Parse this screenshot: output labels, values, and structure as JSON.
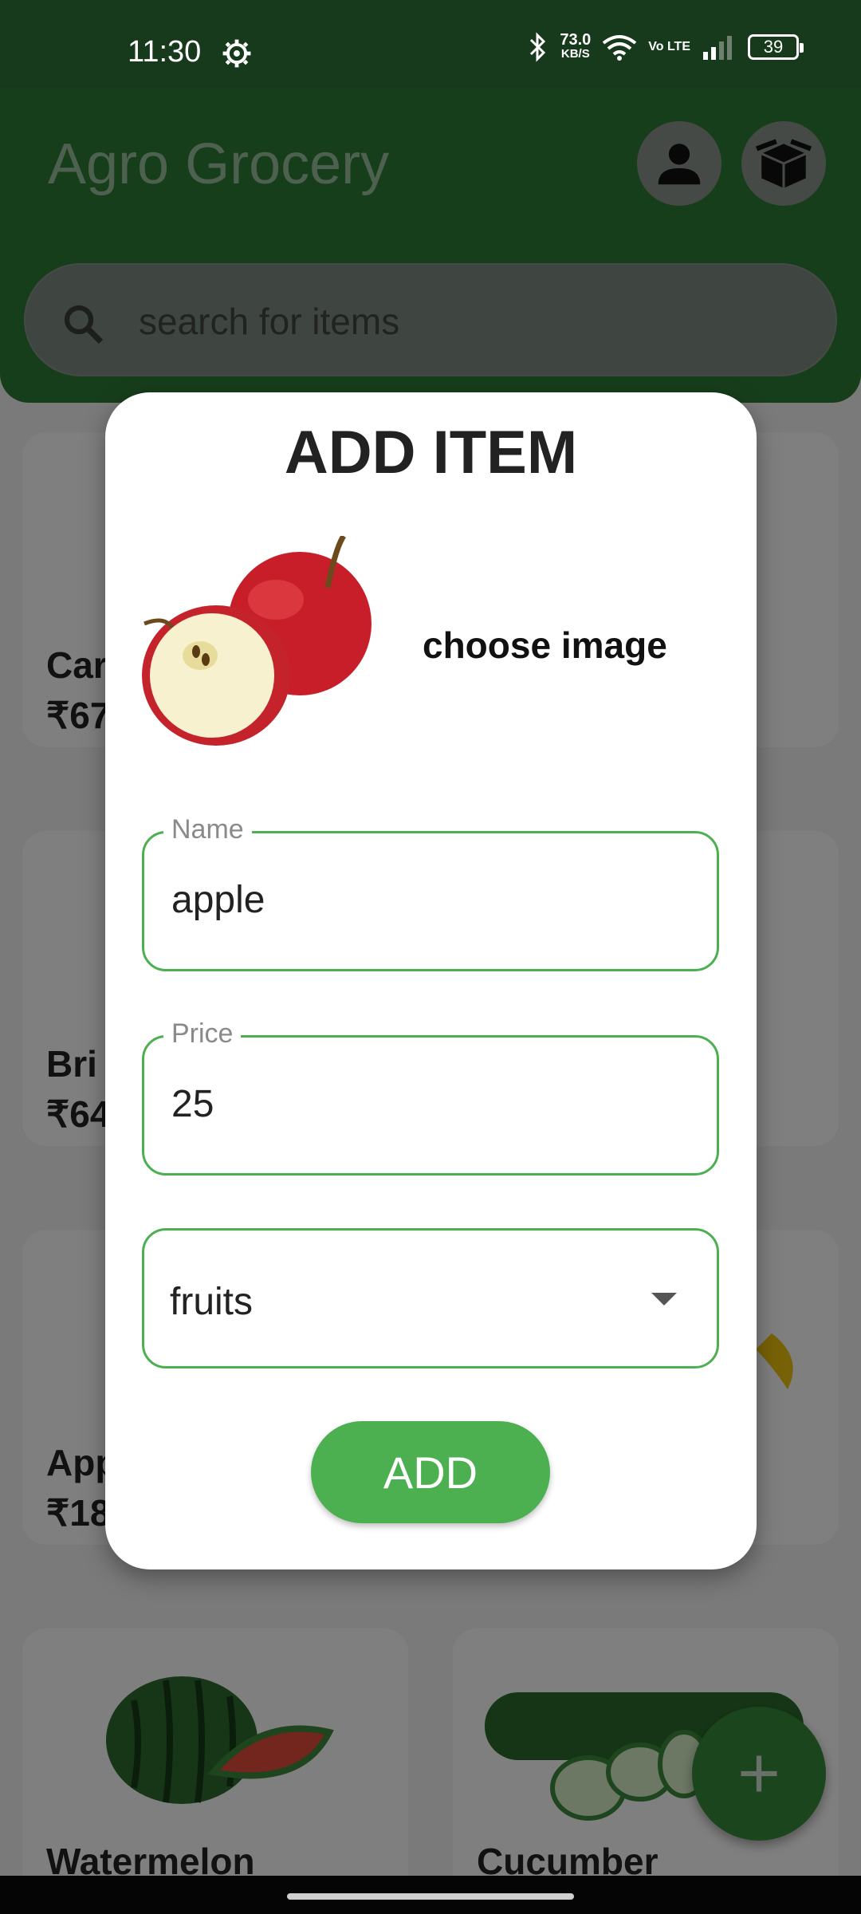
{
  "status_bar": {
    "time": "11:30",
    "speed_value": "73.0",
    "speed_unit": "KB/S",
    "network": "Vo LTE",
    "battery": "39"
  },
  "header": {
    "title": "Agro Grocery",
    "profile_icon": "person-icon",
    "box_icon": "box-icon"
  },
  "search": {
    "placeholder": "search for items"
  },
  "products": [
    {
      "name": "Car",
      "price": "₹67"
    },
    {
      "name": "",
      "price": ""
    },
    {
      "name": "Bri",
      "price": "₹64"
    },
    {
      "name": "",
      "price": ""
    },
    {
      "name": "App",
      "price": "₹18"
    },
    {
      "name": "",
      "price": ""
    },
    {
      "name": "Watermelon",
      "price": ""
    },
    {
      "name": "Cucumber",
      "price": ""
    }
  ],
  "dialog": {
    "title": "ADD ITEM",
    "choose_image_label": "choose image",
    "name_label": "Name",
    "name_value": "apple",
    "price_label": "Price",
    "price_value": "25",
    "category_value": "fruits",
    "add_label": "ADD"
  },
  "colors": {
    "primary": "#4caf50",
    "header": "#2f7d34"
  }
}
